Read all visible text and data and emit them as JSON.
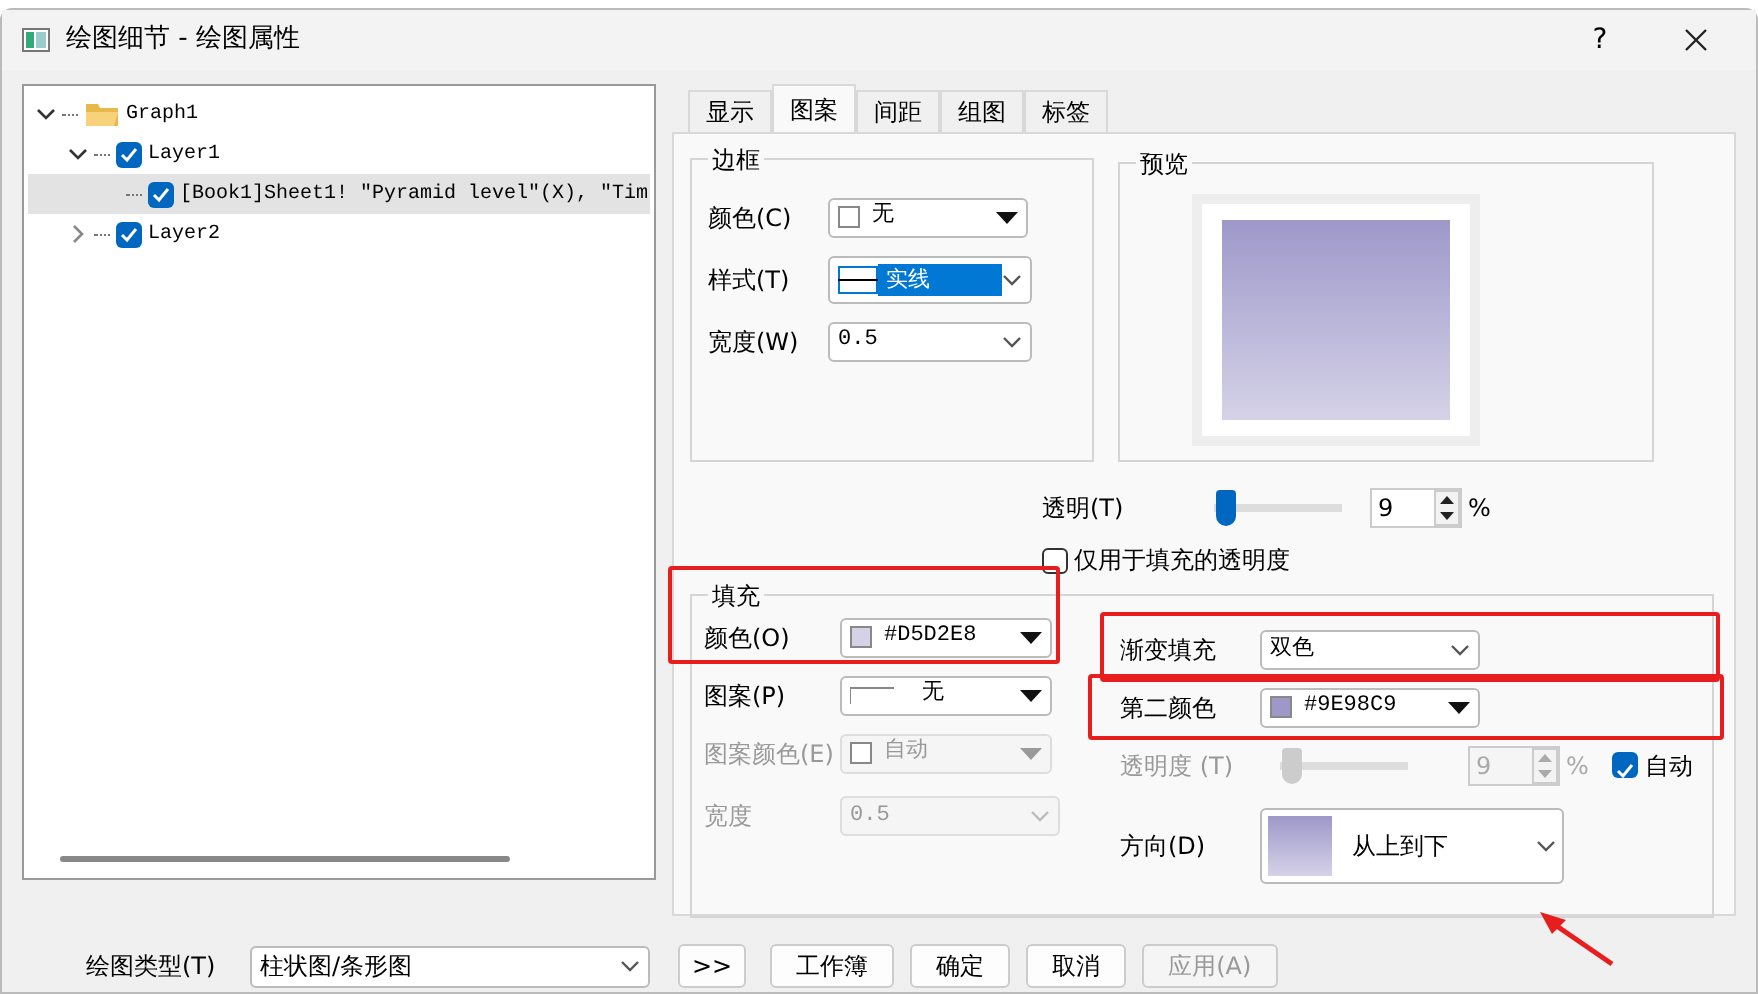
{
  "window": {
    "title": "绘图细节 - 绘图属性",
    "help": "?"
  },
  "tree": [
    {
      "label": "Graph1",
      "selected": false,
      "expanded": true,
      "children": [
        {
          "label": "Layer1",
          "checked": true,
          "selected": false,
          "expanded": true,
          "children": [
            {
              "label": "[Book1]Sheet1! \"Pyramid level\"(X), \"Tim",
              "checked": true,
              "selected": true
            }
          ]
        },
        {
          "label": "Layer2",
          "checked": true,
          "selected": false,
          "expanded": false
        }
      ]
    }
  ],
  "tabs": [
    {
      "label": "显示",
      "selected": false
    },
    {
      "label": "图案",
      "selected": true
    },
    {
      "label": "间距",
      "selected": false
    },
    {
      "label": "组图",
      "selected": false
    },
    {
      "label": "标签",
      "selected": false
    }
  ],
  "border": {
    "title": "边框",
    "color": {
      "label": "颜色(C)",
      "value": "无"
    },
    "style": {
      "label": "样式(T)",
      "value": "实线"
    },
    "width": {
      "label": "宽度(W)",
      "value": "0.5"
    }
  },
  "preview": {
    "title": "预览"
  },
  "transparency": {
    "label": "透明(T)",
    "level": 0.09,
    "value": "9",
    "unit": "%"
  },
  "fill_only_transparency": {
    "label": "仅用于填充的透明度",
    "checked": false
  },
  "fill": {
    "title": "填充",
    "color": {
      "label": "颜色(O)",
      "value": "#D5D2E8",
      "highlighted": true
    },
    "pattern": {
      "label": "图案(P)",
      "value": "无"
    },
    "pattern_color": {
      "label": "图案颜色(E)",
      "value": "自动",
      "disabled": true
    },
    "width": {
      "label": "宽度",
      "value": "0.5",
      "disabled": true
    },
    "gradient": {
      "label": "渐变填充",
      "value": "双色",
      "highlighted": true
    },
    "second_color": {
      "label": "第二颜色",
      "value": "#9E98C9",
      "highlighted": true
    },
    "gradient_transparency": {
      "label": "透明度 (T)",
      "level": 0.09,
      "value": "9",
      "unit": "%",
      "disabled": true
    },
    "auto": {
      "label": "自动",
      "checked": true
    },
    "direction": {
      "label": "方向(D)",
      "value": "从上到下",
      "arrow_pointed": true
    }
  },
  "bottom": {
    "plot_type": {
      "label": "绘图类型(T)",
      "value": "柱状图/条形图"
    },
    "buttons": [
      {
        "label": ">>",
        "disabled": false
      },
      {
        "label": "工作簿",
        "disabled": false
      },
      {
        "label": "确定",
        "disabled": false
      },
      {
        "label": "取消",
        "disabled": false
      },
      {
        "label": "应用(A)",
        "disabled": true
      }
    ]
  }
}
